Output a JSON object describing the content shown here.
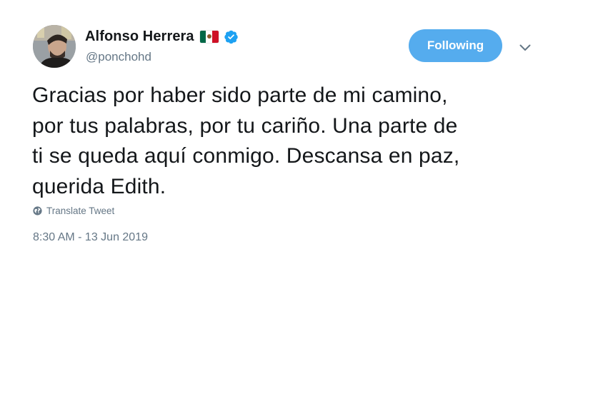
{
  "author": {
    "display_name": "Alfonso Herrera",
    "handle": "@ponchohd",
    "flag_icon": "mexico-flag-emoji",
    "verified_icon": "verified-badge-icon",
    "avatar_icon": "profile-photo"
  },
  "follow_button": {
    "label": "Following"
  },
  "menu": {
    "icon": "chevron-down-icon"
  },
  "tweet": {
    "text": "Gracias por haber sido parte de mi camino,\npor tus palabras, por tu cariño. Una parte de\nti se queda aquí conmigo. Descansa en paz,\nquerida Edith.",
    "translate_label": "Translate Tweet",
    "translate_icon": "globe-icon",
    "timestamp": "8:30 AM - 13 Jun 2019"
  },
  "colors": {
    "accent": "#55acee",
    "text_primary": "#14171a",
    "text_secondary": "#657786",
    "verified": "#1da1f2",
    "flag_green": "#006847",
    "flag_white": "#ffffff",
    "flag_red": "#ce1126"
  }
}
